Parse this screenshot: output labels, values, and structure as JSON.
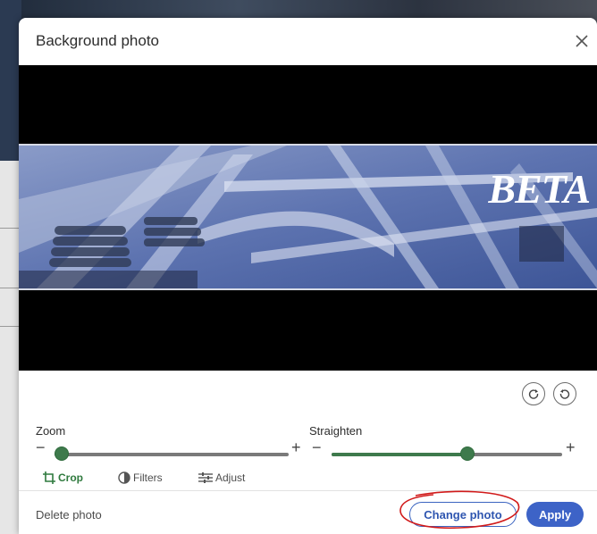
{
  "modal": {
    "title": "Background photo",
    "close_icon": "close-icon"
  },
  "photo": {
    "logo_text": "BETA",
    "description": "steel lattice structure with insulators"
  },
  "rotate": {
    "left_icon": "rotate-counterclockwise-icon",
    "right_icon": "rotate-clockwise-icon"
  },
  "zoom": {
    "label": "Zoom",
    "minus": "−",
    "plus": "+",
    "value": 0.03
  },
  "straighten": {
    "label": "Straighten",
    "minus": "−",
    "plus": "+",
    "value": 0.5
  },
  "tools": [
    {
      "label": "Crop",
      "icon": "crop-icon",
      "active": true
    },
    {
      "label": "Filters",
      "icon": "filters-icon",
      "active": false
    },
    {
      "label": "Adjust",
      "icon": "adjust-icon",
      "active": false
    }
  ],
  "footer": {
    "delete_label": "Delete photo",
    "change_label": "Change photo",
    "apply_label": "Apply"
  },
  "colors": {
    "accent_blue": "#3d63c7",
    "slider_green": "#3e7a4c",
    "annotation_red": "#d11a1a"
  }
}
